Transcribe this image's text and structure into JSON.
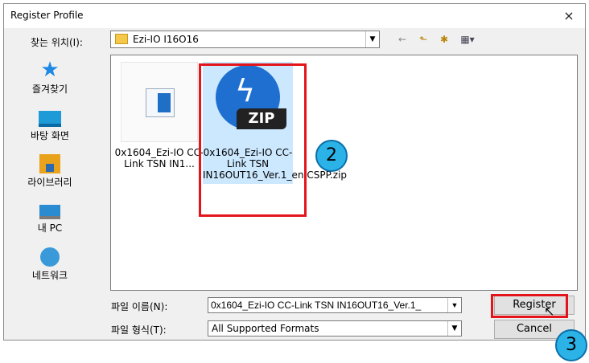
{
  "dialog": {
    "title": "Register Profile",
    "close_icon": "×"
  },
  "lookin": {
    "label": "찾는 위치(I):",
    "value": "Ezi-IO I16O16"
  },
  "toolbar": {
    "back": "←",
    "up": "⬑",
    "new_folder": "✱",
    "view_menu": "▦▾"
  },
  "places": [
    {
      "label": "즐겨찾기",
      "icon": "star-icon"
    },
    {
      "label": "바탕 화면",
      "icon": "desktop-icon"
    },
    {
      "label": "라이브러리",
      "icon": "library-icon"
    },
    {
      "label": "내 PC",
      "icon": "pc-icon"
    },
    {
      "label": "네트워크",
      "icon": "network-icon"
    }
  ],
  "files": [
    {
      "name": "0x1604_Ezi-IO CC-Link TSN IN1...",
      "icon": "document-icon"
    },
    {
      "name": "0x1604_Ezi-IO CC-Link TSN IN16OUT16_Ver.1_en.CSPP.zip",
      "icon": "zip-icon",
      "badge": "ZIP",
      "selected": true
    }
  ],
  "filename": {
    "label": "파일 이름(N):",
    "value": "0x1604_Ezi-IO CC-Link TSN IN16OUT16_Ver.1_"
  },
  "filetype": {
    "label": "파일 형식(T):",
    "value": "All Supported Formats"
  },
  "buttons": {
    "register": "Register",
    "cancel": "Cancel"
  },
  "annotations": {
    "step2": "2",
    "step3": "3",
    "highlight_color": "#e3151a",
    "badge_color": "#2bb3e8"
  }
}
